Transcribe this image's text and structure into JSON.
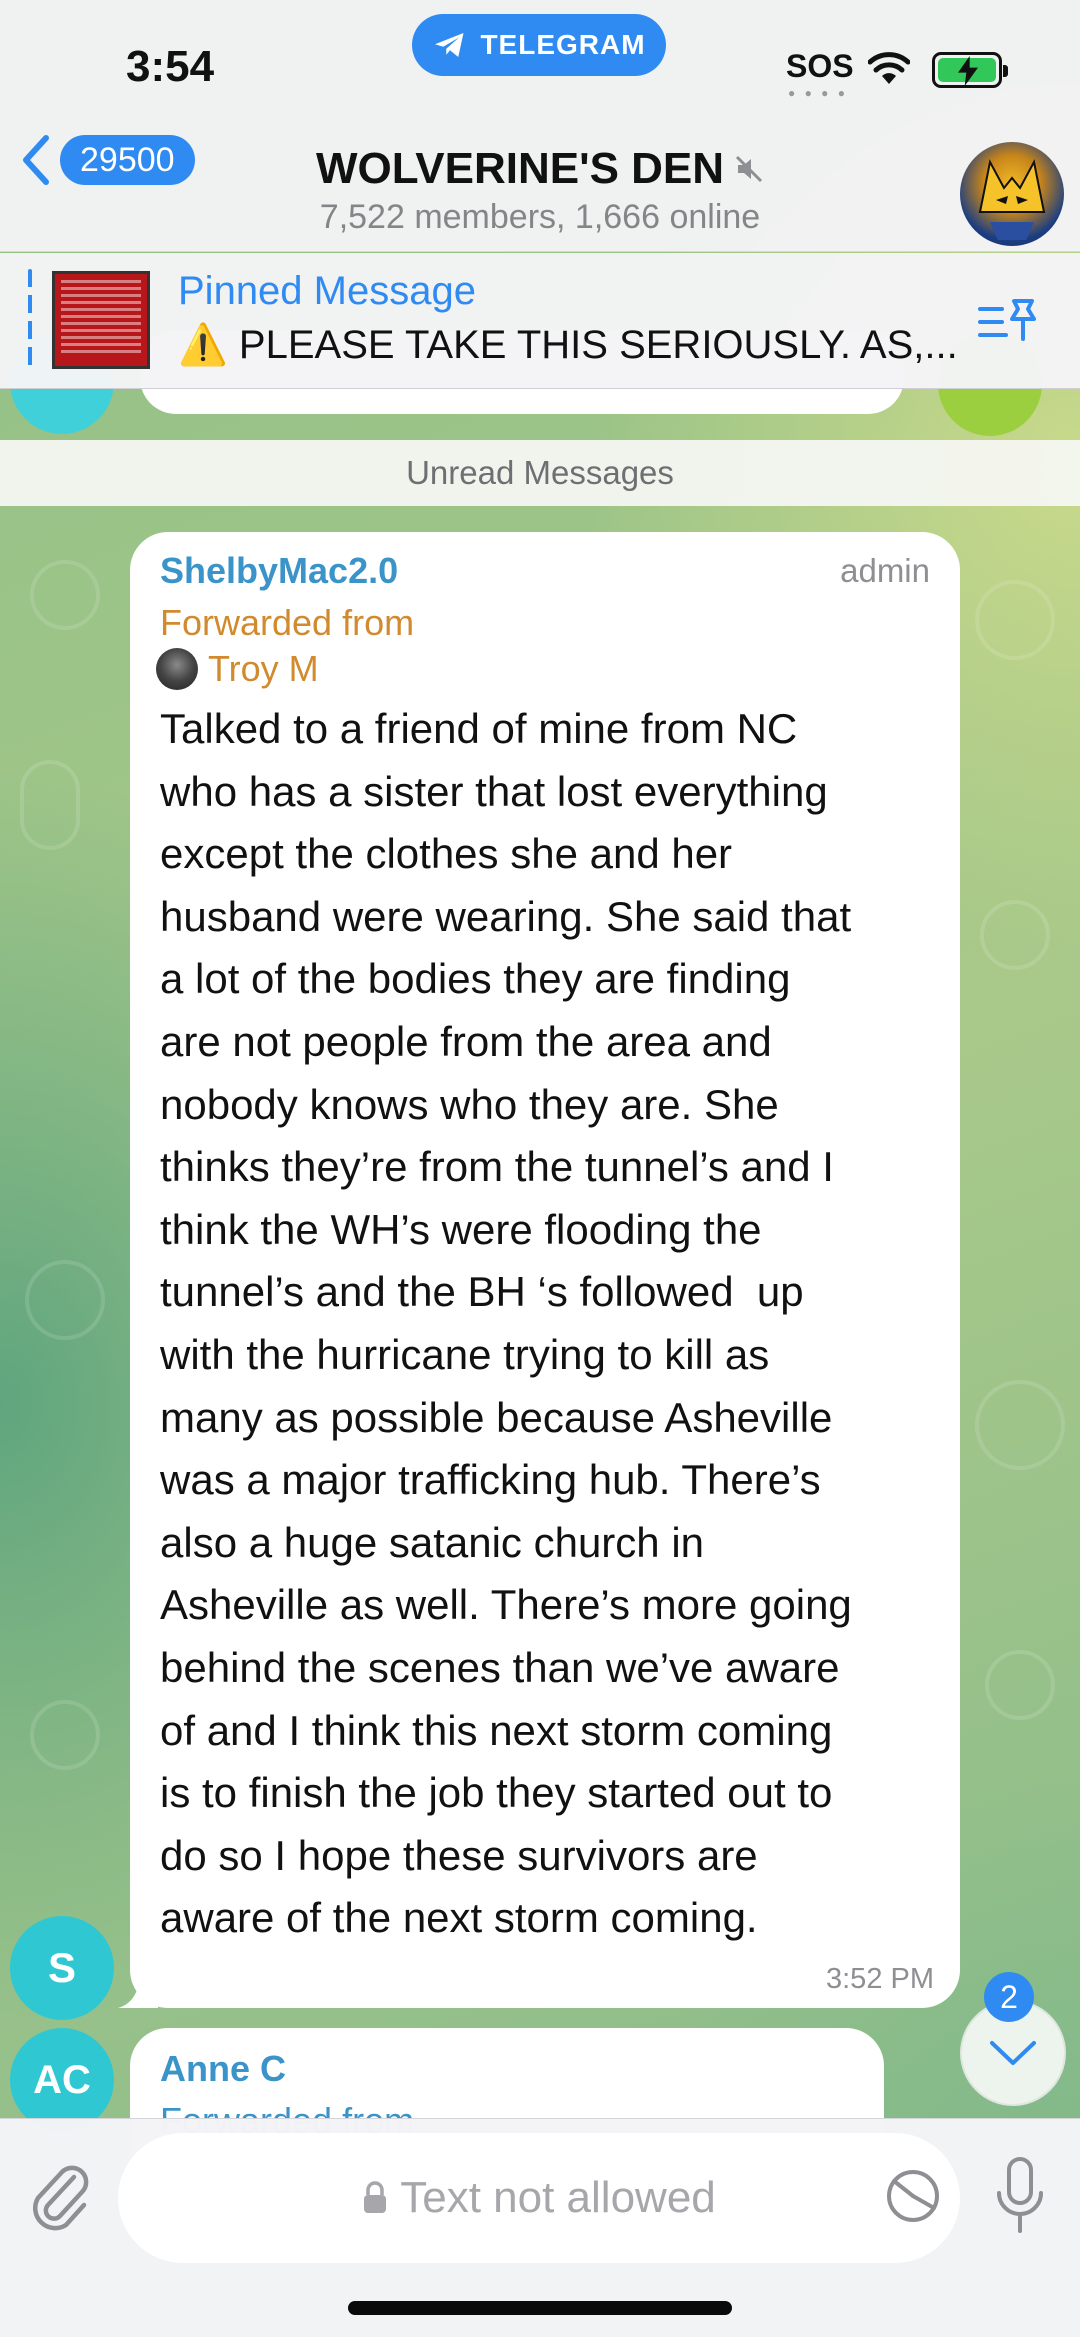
{
  "status_bar": {
    "time": "3:54",
    "back_to_app": "TELEGRAM",
    "carrier": "SOS"
  },
  "header": {
    "back_count": "29500",
    "title": "WOLVERINE'S DEN",
    "subtitle": "7,522 members, 1,666 online"
  },
  "pinned": {
    "title": "Pinned Message",
    "text": "⚠️ PLEASE TAKE THIS SERIOUSLY. AS,..."
  },
  "divider": {
    "label": "Unread Messages"
  },
  "messages": [
    {
      "sender": "ShelbyMac2.0",
      "role": "admin",
      "forwarded_label": "Forwarded from",
      "forwarded_from": "Troy M",
      "avatar_initial": "S",
      "text": "Talked to a friend of mine from NC\nwho has a sister that lost everything\nexcept the clothes she and her\nhusband were wearing. She said that\na lot of the bodies they are finding\nare not people from the area and\nnobody knows who they are. She\nthinks they’re from the tunnel’s and I\nthink the WH’s were flooding the\ntunnel’s and the BH ‘s followed  up\nwith the hurricane trying to kill as\nmany as possible because Asheville\nwas a major trafficking hub. There’s\nalso a huge satanic church in\nAsheville as well. There’s more going\nbehind the scenes than we’ve aware\nof and I think this next storm coming\nis to finish the job they started out to\ndo so I hope these survivors are\naware of the next storm coming.",
      "time": "3:52 PM"
    },
    {
      "sender": "Anne C",
      "forwarded_label": "Forwarded from",
      "avatar_initial": "AC"
    }
  ],
  "scroll_down": {
    "unread_count": "2"
  },
  "input": {
    "placeholder": "Text not allowed"
  },
  "colors": {
    "accent": "#2f8bf2",
    "sender_name": "#3a94c9",
    "forwarded": "#d18a2e",
    "avatar": "#2fc8d2"
  }
}
